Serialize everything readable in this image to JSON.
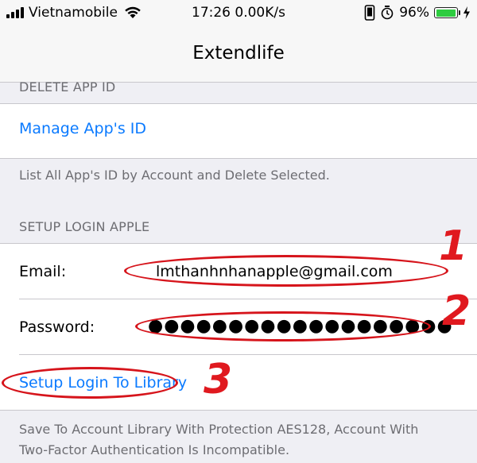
{
  "status_bar": {
    "carrier": "Vietnamobile",
    "time_speed": "17:26 0.00K/s",
    "battery_percent": "96%",
    "battery_level": 0.96,
    "battery_color": "#2ecc40",
    "icons": [
      "signal-icon",
      "wifi-icon",
      "phone-icon",
      "alarm-icon",
      "battery-icon",
      "charging-icon"
    ]
  },
  "nav": {
    "title": "Extendlife"
  },
  "delete_section": {
    "header": "DELETE APP ID",
    "manage_link": "Manage App's ID",
    "footer": "List All App's ID by Account and Delete Selected."
  },
  "login_section": {
    "header": "SETUP LOGIN APPLE",
    "email_label": "Email:",
    "email_value": "lmthanhnhanapple@gmail.com",
    "password_label": "Password:",
    "password_mask": "●●●●●●●●●●●●●●●●●●●",
    "setup_link": "Setup Login To Library",
    "footer": "Save To Account Library With Protection AES128, Account With Two-Factor Authentication Is Incompatible."
  },
  "annotations": {
    "step1": "1",
    "step2": "2",
    "step3": "3",
    "color": "#d6141b"
  },
  "colors": {
    "link": "#0a7aff",
    "background": "#efeff4",
    "secondary_text": "#6d6d72"
  }
}
